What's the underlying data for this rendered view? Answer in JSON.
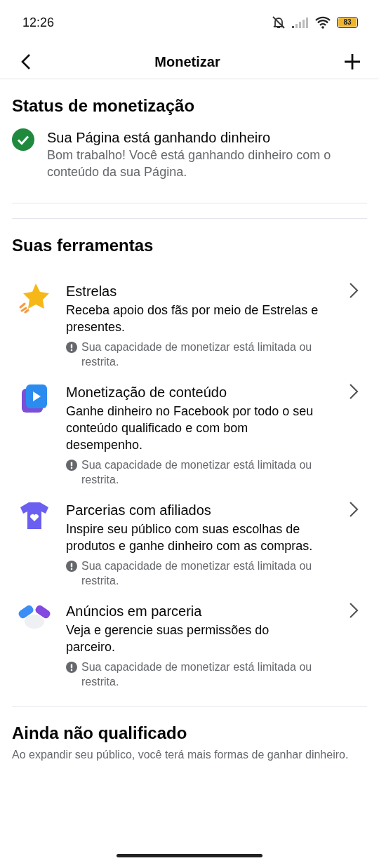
{
  "status_bar": {
    "time": "12:26",
    "battery": "83"
  },
  "header": {
    "title": "Monetizar"
  },
  "status_section": {
    "title": "Status de monetização",
    "status_title": "Sua Página está ganhando dinheiro",
    "status_text": "Bom trabalho! Você está ganhando dinheiro com o conteúdo da sua Página."
  },
  "tools_section": {
    "title": "Suas ferramentas",
    "tools": [
      {
        "kind": "star",
        "title": "Estrelas",
        "description": "Receba apoio dos fãs por meio de Estrelas e presentes.",
        "warning": "Sua capacidade de monetizar está limitada ou restrita."
      },
      {
        "kind": "video",
        "title": "Monetização de conteúdo",
        "description": "Ganhe dinheiro no Facebook por todo o seu conteúdo qualificado e com bom desempenho.",
        "warning": "Sua capacidade de monetizar está limitada ou restrita."
      },
      {
        "kind": "shirt",
        "title": "Parcerias com afiliados",
        "description": "Inspire seu público com suas escolhas de produtos e ganhe dinheiro com as compras.",
        "warning": "Sua capacidade de monetizar está limitada ou restrita."
      },
      {
        "kind": "handshake",
        "title": "Anúncios em parceria",
        "description": "Veja e gerencie suas permissões do parceiro.",
        "warning": "Sua capacidade de monetizar está limitada ou restrita."
      }
    ]
  },
  "not_qualified": {
    "title": "Ainda não qualificado",
    "text": "Ao expandir seu público, você terá mais formas de ganhar dinheiro."
  }
}
